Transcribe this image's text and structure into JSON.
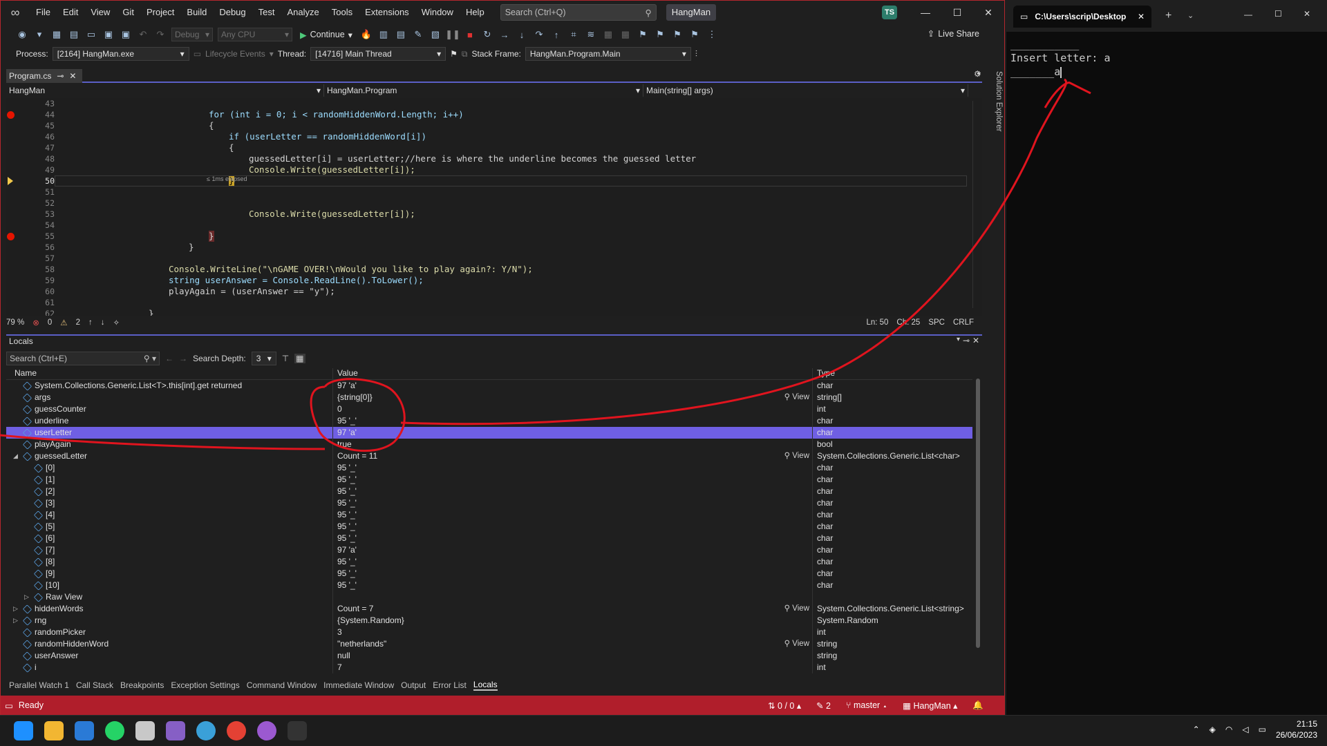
{
  "menu": [
    "File",
    "Edit",
    "View",
    "Git",
    "Project",
    "Build",
    "Debug",
    "Test",
    "Analyze",
    "Tools",
    "Extensions",
    "Window",
    "Help"
  ],
  "search": {
    "placeholder": "Search (Ctrl+Q)"
  },
  "solution_name": "HangMan",
  "avatar_initials": "TS",
  "toolbar": {
    "config": "Debug",
    "platform": "Any CPU",
    "continue_label": "Continue",
    "live_share_label": "Live Share"
  },
  "debug_location": {
    "process_label": "Process:",
    "process_value": "[2164] HangMan.exe",
    "lifecycle_label": "Lifecycle Events",
    "thread_label": "Thread:",
    "thread_value": "[14716] Main Thread",
    "stack_frame_label": "Stack Frame:",
    "stack_frame_value": "HangMan.Program.Main"
  },
  "document_tab": {
    "label": "Program.cs"
  },
  "nav": {
    "project": "HangMan",
    "class": "HangMan.Program",
    "member": "Main(string[] args)"
  },
  "solution_explorer_label": "Solution Explorer",
  "editor": {
    "elapsed": "≤ 1ms elapsed",
    "line_numbers": [
      "43",
      "44",
      "45",
      "46",
      "47",
      "48",
      "49",
      "50",
      "51",
      "52",
      "53",
      "54",
      "55",
      "56",
      "57",
      "58",
      "59",
      "60",
      "61",
      "62"
    ],
    "lines": [
      {
        "text": ""
      },
      {
        "text": "for (int i = 0; i < randomHiddenWord.Length; i++)"
      },
      {
        "text": "{"
      },
      {
        "text": "if (userLetter == randomHiddenWord[i])"
      },
      {
        "text": "{"
      },
      {
        "text": "guessedLetter[i] = userLetter;//here is where the underline becomes the guessed letter"
      },
      {
        "text": "Console.Write(guessedLetter[i]);"
      },
      {
        "text": "}"
      },
      {
        "text": ""
      },
      {
        "text": ""
      },
      {
        "text": "Console.Write(guessedLetter[i]);"
      },
      {
        "text": ""
      },
      {
        "text": "}"
      },
      {
        "text": "}"
      },
      {
        "text": ""
      },
      {
        "text": "Console.WriteLine(\"\\nGAME OVER!\\nWould you like to play again?: Y/N\");"
      },
      {
        "text": "string userAnswer = Console.ReadLine().ToLower();"
      },
      {
        "text": "playAgain = (userAnswer == \"y\");"
      },
      {
        "text": ""
      },
      {
        "text": "}"
      }
    ]
  },
  "editor_status": {
    "zoom": "79 %",
    "errors": "0",
    "warnings": "2",
    "line": "Ln: 50",
    "col": "Ch: 25",
    "spc": "SPC",
    "eol": "CRLF"
  },
  "locals": {
    "title": "Locals",
    "search_placeholder": "Search (Ctrl+E)",
    "search_depth_label": "Search Depth:",
    "search_depth_value": "3",
    "columns": [
      "Name",
      "Value",
      "Type"
    ],
    "rows": [
      {
        "name": "System.Collections.Generic.List<T>.this[int].get returned",
        "value": "97 'a'",
        "type": "char",
        "indent": 1,
        "expander": "",
        "view": ""
      },
      {
        "name": "args",
        "value": "{string[0]}",
        "type": "string[]",
        "indent": 1,
        "expander": "",
        "view": "View"
      },
      {
        "name": "guessCounter",
        "value": "0",
        "type": "int",
        "indent": 1,
        "expander": "",
        "view": ""
      },
      {
        "name": "underline",
        "value": "95 '_'",
        "type": "char",
        "indent": 1,
        "expander": "",
        "view": ""
      },
      {
        "name": "userLetter",
        "value": "97 'a'",
        "type": "char",
        "indent": 1,
        "expander": "",
        "view": "",
        "selected": true
      },
      {
        "name": "playAgain",
        "value": "true",
        "type": "bool",
        "indent": 1,
        "expander": "",
        "view": ""
      },
      {
        "name": "guessedLetter",
        "value": "Count = 11",
        "type": "System.Collections.Generic.List<char>",
        "indent": 1,
        "expander": "◢",
        "view": "View"
      },
      {
        "name": "[0]",
        "value": "95 '_'",
        "type": "char",
        "indent": 2,
        "expander": "",
        "view": ""
      },
      {
        "name": "[1]",
        "value": "95 '_'",
        "type": "char",
        "indent": 2,
        "expander": "",
        "view": ""
      },
      {
        "name": "[2]",
        "value": "95 '_'",
        "type": "char",
        "indent": 2,
        "expander": "",
        "view": ""
      },
      {
        "name": "[3]",
        "value": "95 '_'",
        "type": "char",
        "indent": 2,
        "expander": "",
        "view": ""
      },
      {
        "name": "[4]",
        "value": "95 '_'",
        "type": "char",
        "indent": 2,
        "expander": "",
        "view": ""
      },
      {
        "name": "[5]",
        "value": "95 '_'",
        "type": "char",
        "indent": 2,
        "expander": "",
        "view": ""
      },
      {
        "name": "[6]",
        "value": "95 '_'",
        "type": "char",
        "indent": 2,
        "expander": "",
        "view": ""
      },
      {
        "name": "[7]",
        "value": "97 'a'",
        "type": "char",
        "indent": 2,
        "expander": "",
        "view": ""
      },
      {
        "name": "[8]",
        "value": "95 '_'",
        "type": "char",
        "indent": 2,
        "expander": "",
        "view": ""
      },
      {
        "name": "[9]",
        "value": "95 '_'",
        "type": "char",
        "indent": 2,
        "expander": "",
        "view": ""
      },
      {
        "name": "[10]",
        "value": "95 '_'",
        "type": "char",
        "indent": 2,
        "expander": "",
        "view": ""
      },
      {
        "name": "Raw View",
        "value": "",
        "type": "",
        "indent": 2,
        "expander": "▷",
        "view": ""
      },
      {
        "name": "hiddenWords",
        "value": "Count = 7",
        "type": "System.Collections.Generic.List<string>",
        "indent": 1,
        "expander": "▷",
        "view": "View"
      },
      {
        "name": "rng",
        "value": "{System.Random}",
        "type": "System.Random",
        "indent": 1,
        "expander": "▷",
        "view": ""
      },
      {
        "name": "randomPicker",
        "value": "3",
        "type": "int",
        "indent": 1,
        "expander": "",
        "view": ""
      },
      {
        "name": "randomHiddenWord",
        "value": "\"netherlands\"",
        "type": "string",
        "indent": 1,
        "expander": "",
        "view": "View"
      },
      {
        "name": "userAnswer",
        "value": "null",
        "type": "string",
        "indent": 1,
        "expander": "",
        "view": ""
      },
      {
        "name": "i",
        "value": "7",
        "type": "int",
        "indent": 1,
        "expander": "",
        "view": ""
      }
    ]
  },
  "bottom_tabs": [
    "Parallel Watch 1",
    "Call Stack",
    "Breakpoints",
    "Exception Settings",
    "Command Window",
    "Immediate Window",
    "Output",
    "Error List",
    "Locals"
  ],
  "statusbar": {
    "ready": "Ready",
    "changes": "0 / 0",
    "edits": "2",
    "branch": "master",
    "repo": "HangMan"
  },
  "terminal": {
    "tab_title": "C:\\Users\\scrip\\Desktop",
    "lines": [
      "___________",
      "Insert letter: a",
      "_______a"
    ]
  },
  "clock": {
    "time": "21:15",
    "date": "26/06/2023"
  },
  "colors": {
    "statusbar": "#b01e2b",
    "selection": "#6f5fe3",
    "accent": "#5b5fc7",
    "annotation": "#e0141e"
  }
}
